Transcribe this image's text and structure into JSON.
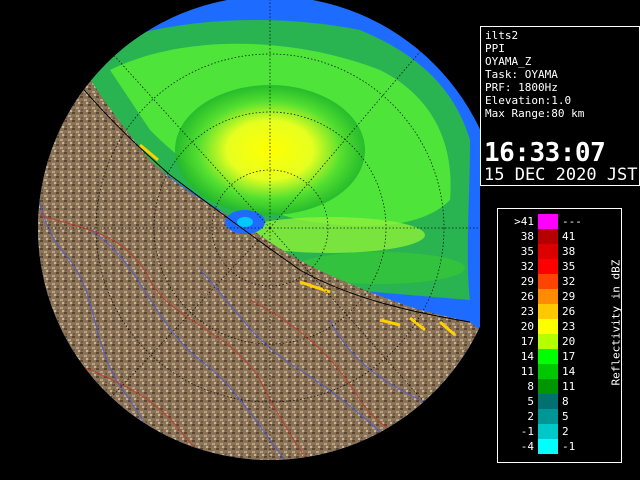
{
  "info": {
    "product": "ilts2",
    "mode": "PPI",
    "site": "OYAMA_Z",
    "task": "Task: OYAMA",
    "prf": "PRF: 1800Hz",
    "elevation": "Elevation:1.0",
    "max_range": "Max Range:80 km",
    "time": "16:33:07",
    "date": "15 DEC 2020 JST"
  },
  "legend": {
    "unit_label": "Reflectivity in dBZ",
    "rows": [
      {
        "low": ">41",
        "high": "---",
        "color": "#ff00ff"
      },
      {
        "low": "38",
        "high": "41",
        "color": "#b40000"
      },
      {
        "low": "35",
        "high": "38",
        "color": "#dc0000"
      },
      {
        "low": "32",
        "high": "35",
        "color": "#ff0000"
      },
      {
        "low": "29",
        "high": "32",
        "color": "#ff4400"
      },
      {
        "low": "26",
        "high": "29",
        "color": "#ff8c00"
      },
      {
        "low": "23",
        "high": "26",
        "color": "#ffc800"
      },
      {
        "low": "20",
        "high": "23",
        "color": "#ffff00"
      },
      {
        "low": "17",
        "high": "20",
        "color": "#b4ff00"
      },
      {
        "low": "14",
        "high": "17",
        "color": "#00ff00"
      },
      {
        "low": "11",
        "high": "14",
        "color": "#00c800"
      },
      {
        "low": "8",
        "high": "11",
        "color": "#009600"
      },
      {
        "low": "5",
        "high": "8",
        "color": "#007070"
      },
      {
        "low": "2",
        "high": "5",
        "color": "#009696"
      },
      {
        "low": "-1",
        "high": "2",
        "color": "#00c8c8"
      },
      {
        "low": "-4",
        "high": "-1",
        "color": "#00ffff"
      }
    ]
  }
}
